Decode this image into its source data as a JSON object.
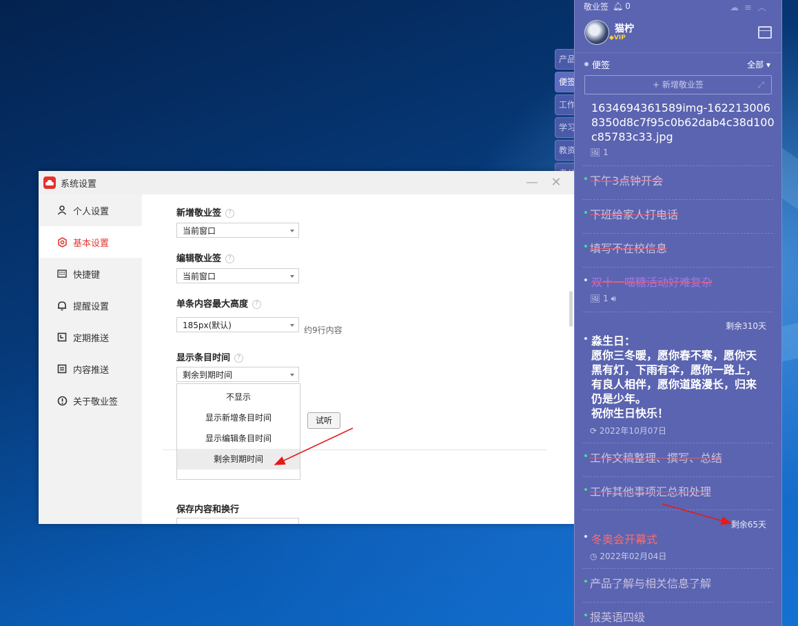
{
  "side_tabs": [
    "产品",
    "便签",
    "工作",
    "学习",
    "教资",
    "考公"
  ],
  "settings_window": {
    "title": "系统设置",
    "nav": [
      {
        "label": "个人设置",
        "icon": "user-icon"
      },
      {
        "label": "基本设置",
        "icon": "settings-icon",
        "active": true
      },
      {
        "label": "快捷键",
        "icon": "keyboard-icon"
      },
      {
        "label": "提醒设置",
        "icon": "bell-icon"
      },
      {
        "label": "定期推送",
        "icon": "calendar-icon"
      },
      {
        "label": "内容推送",
        "icon": "document-icon"
      },
      {
        "label": "关于敬业签",
        "icon": "info-icon"
      }
    ],
    "new_note": {
      "label": "新增敬业签",
      "value": "当前窗口"
    },
    "edit_note": {
      "label": "编辑敬业签",
      "value": "当前窗口"
    },
    "max_height": {
      "label": "单条内容最大高度",
      "value": "185px(默认)",
      "hint": "约9行内容"
    },
    "show_time": {
      "label": "显示条目时间",
      "value": "剩余到期时间",
      "options": [
        "不显示",
        "显示新增条目时间",
        "显示编辑条目时间",
        "剩余到期时间"
      ]
    },
    "listen_button": "试听",
    "save_section": {
      "label": "保存内容和换行"
    }
  },
  "notes_panel": {
    "app_name": "敬业签",
    "bell_count": "0",
    "user": {
      "name": "猫柠",
      "badge": "VIP"
    },
    "section": "便签",
    "filter": "全部",
    "add_button": "新增敬业签",
    "notes": [
      {
        "text": "1634694361589img-162213006\n8350d8c7f95c0b62dab4c38d100\nc85783c33.jpg",
        "meta": "1"
      },
      {
        "text": "下午3点钟开会"
      },
      {
        "text": "下班给家人打电话"
      },
      {
        "text": "填写不在校信息"
      },
      {
        "text": "双十一喵糖活动好难复杂",
        "meta": "1"
      },
      {
        "remaining": "剩余310天",
        "text": "淼生日：\n愿你三冬暖，愿你春不寒，愿你天\n黑有灯，下雨有伞，愿你一路上，\n有良人相伴，愿你道路漫长，归来\n仍是少年。\n祝你生日快乐！",
        "date": "2022年10月07日"
      },
      {
        "text": "工作文稿整理、撰写、总结"
      },
      {
        "text": "工作其他事项汇总和处理"
      },
      {
        "remaining": "剩余65天",
        "text": "冬奥会开幕式",
        "date": "2022年02月04日"
      },
      {
        "text": "产品了解与相关信息了解"
      },
      {
        "text": "报英语四级"
      }
    ]
  },
  "colors": {
    "accent": "#e03b35",
    "panel_bg": "#5b64b0",
    "done_dot": "#42e08c",
    "arrow": "#e61919"
  }
}
